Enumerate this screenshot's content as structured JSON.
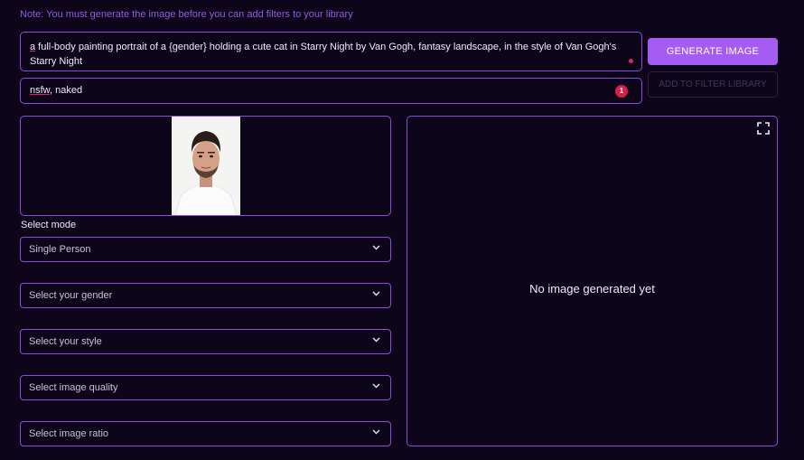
{
  "note": "Note: You must generate the image before you can add filters to your library",
  "prompt": {
    "first_word": "a",
    "rest": " full-body painting portrait of a {gender} holding a cute cat in Starry Night by Van Gogh, fantasy landscape, in the style of Van Gogh's Starry Night"
  },
  "negative_prompt": {
    "first_word": "nsfw",
    "rest": ", naked",
    "error_count": "1"
  },
  "buttons": {
    "generate": "GENERATE IMAGE",
    "add_filter": "ADD TO FILTER LIBRARY"
  },
  "select_mode_label": "Select mode",
  "dropdowns": {
    "mode": "Single Person",
    "gender": "Select your gender",
    "style": "Select your style",
    "quality": "Select image quality",
    "ratio": "Select image ratio"
  },
  "output": {
    "empty_text": "No image generated yet"
  },
  "colors": {
    "background": "#0d0519",
    "accent": "#8a4ddb",
    "button": "#a45cf2",
    "note": "#8f5de6",
    "error": "#d81e49"
  },
  "icons": [
    "chevron-down-icon",
    "fullscreen-icon"
  ]
}
